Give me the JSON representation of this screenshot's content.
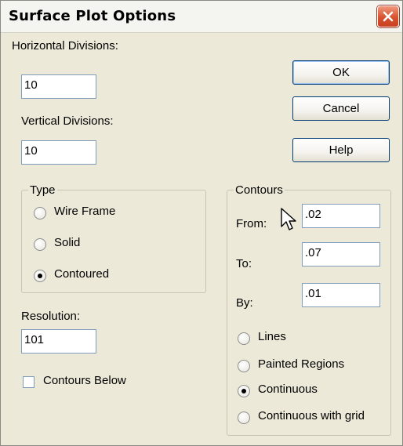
{
  "window": {
    "title": "Surface Plot Options"
  },
  "fields": {
    "horizontal_divisions": {
      "label": "Horizontal Divisions:",
      "value": "10"
    },
    "vertical_divisions": {
      "label": "Vertical Divisions:",
      "value": "10"
    },
    "resolution": {
      "label": "Resolution:",
      "value": "101"
    }
  },
  "buttons": {
    "ok": "OK",
    "cancel": "Cancel",
    "help": "Help"
  },
  "type_group": {
    "legend": "Type",
    "options": [
      "Wire Frame",
      "Solid",
      "Contoured"
    ],
    "selected": "Contoured"
  },
  "contours_below": {
    "label": "Contours Below",
    "checked": false
  },
  "contours_group": {
    "legend": "Contours",
    "from": {
      "label": "From:",
      "value": ".02"
    },
    "to": {
      "label": "To:",
      "value": ".07"
    },
    "by": {
      "label": "By:",
      "value": ".01"
    },
    "options": [
      "Lines",
      "Painted Regions",
      "Continuous",
      "Continuous with grid"
    ],
    "selected": "Continuous"
  },
  "icons": {
    "close": "close-icon",
    "cursor": "mouse-pointer-icon"
  },
  "colors": {
    "dialog_face": "#ece9d8",
    "close_button": "#d8522e",
    "field_border": "#7f9db9"
  }
}
